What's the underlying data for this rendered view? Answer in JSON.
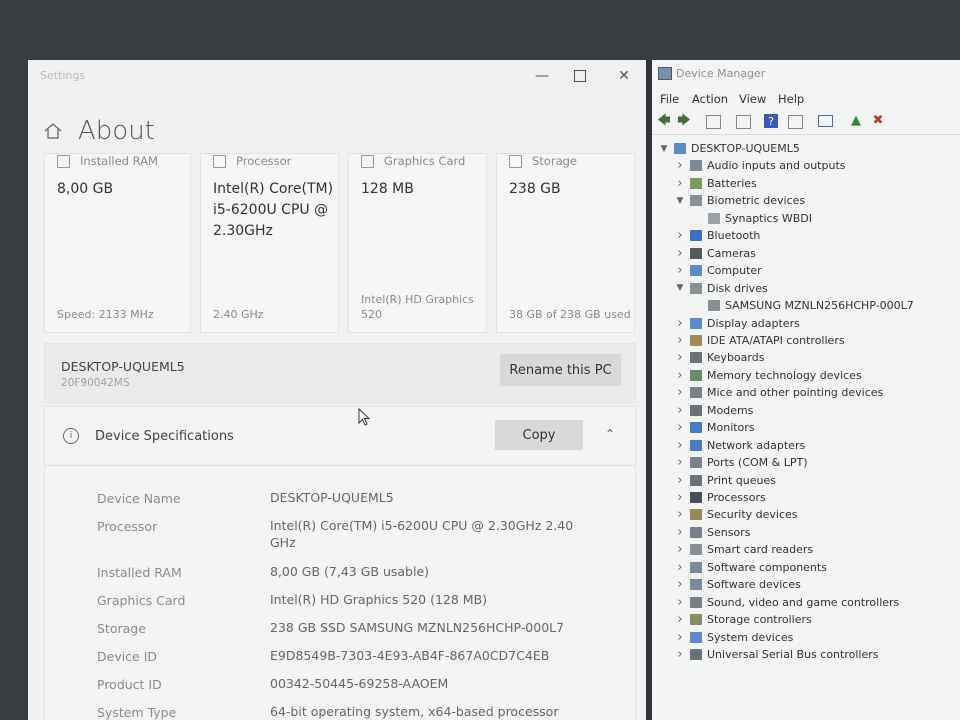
{
  "settings": {
    "app_title": "Settings",
    "page_title": "About",
    "tiles": [
      {
        "label": "Installed RAM",
        "value": "8,00 GB",
        "sub": "Speed: 2133 MHz"
      },
      {
        "label": "Processor",
        "value": "Intel(R) Core(TM) i5-6200U CPU @ 2.30GHz",
        "sub": "2.40 GHz"
      },
      {
        "label": "Graphics Card",
        "value": "128 MB",
        "sub": "Intel(R) HD Graphics 520"
      },
      {
        "label": "Storage",
        "value": "238 GB",
        "sub": "38 GB of 238 GB used"
      }
    ],
    "pc_name": "DESKTOP-UQUEML5",
    "pc_model": "20F90042MS",
    "rename_label": "Rename this PC",
    "spec_title": "Device Specifications",
    "copy_label": "Copy",
    "specs": [
      {
        "label": "Device Name",
        "value": "DESKTOP-UQUEML5"
      },
      {
        "label": "Processor",
        "value": "Intel(R) Core(TM) i5-6200U CPU @ 2.30GHz   2.40 GHz"
      },
      {
        "label": "Installed RAM",
        "value": "8,00 GB (7,43 GB usable)"
      },
      {
        "label": "Graphics Card",
        "value": "Intel(R) HD Graphics 520 (128 MB)"
      },
      {
        "label": "Storage",
        "value": "238 GB SSD SAMSUNG MZNLN256HCHP-000L7"
      },
      {
        "label": "Device ID",
        "value": "E9D8549B-7303-4E93-AB4F-867A0CD7C4EB"
      },
      {
        "label": "Product ID",
        "value": "00342-50445-69258-AAOEM"
      },
      {
        "label": "System Type",
        "value": "64-bit operating system, x64-based processor"
      }
    ]
  },
  "devmgr": {
    "title": "Device Manager",
    "menu": [
      "File",
      "Action",
      "View",
      "Help"
    ],
    "root": "DESKTOP-UQUEML5",
    "nodes": [
      {
        "label": "Audio inputs and outputs",
        "level": 1,
        "state": "collapsed",
        "color": "#7e8c98"
      },
      {
        "label": "Batteries",
        "level": 1,
        "state": "collapsed",
        "color": "#7a9a5a"
      },
      {
        "label": "Biometric devices",
        "level": 1,
        "state": "expanded",
        "color": "#8a8f95"
      },
      {
        "label": "Synaptics WBDI",
        "level": 2,
        "state": "leaf",
        "color": "#9aa0a6"
      },
      {
        "label": "Bluetooth",
        "level": 1,
        "state": "collapsed",
        "color": "#3a6fc8"
      },
      {
        "label": "Cameras",
        "level": 1,
        "state": "collapsed",
        "color": "#555a60"
      },
      {
        "label": "Computer",
        "level": 1,
        "state": "collapsed",
        "color": "#5a8ac8"
      },
      {
        "label": "Disk drives",
        "level": 1,
        "state": "expanded",
        "color": "#8a8f95"
      },
      {
        "label": "SAMSUNG MZNLN256HCHP-000L7",
        "level": 2,
        "state": "leaf",
        "color": "#8a8f95"
      },
      {
        "label": "Display adapters",
        "level": 1,
        "state": "collapsed",
        "color": "#5a8ac8"
      },
      {
        "label": "IDE ATA/ATAPI controllers",
        "level": 1,
        "state": "collapsed",
        "color": "#a08a5a"
      },
      {
        "label": "Keyboards",
        "level": 1,
        "state": "collapsed",
        "color": "#6a7078"
      },
      {
        "label": "Memory technology devices",
        "level": 1,
        "state": "collapsed",
        "color": "#6a8a6a"
      },
      {
        "label": "Mice and other pointing devices",
        "level": 1,
        "state": "collapsed",
        "color": "#7a8088"
      },
      {
        "label": "Modems",
        "level": 1,
        "state": "collapsed",
        "color": "#6a7078"
      },
      {
        "label": "Monitors",
        "level": 1,
        "state": "collapsed",
        "color": "#4a7ac8"
      },
      {
        "label": "Network adapters",
        "level": 1,
        "state": "collapsed",
        "color": "#4a7ac8"
      },
      {
        "label": "Ports (COM & LPT)",
        "level": 1,
        "state": "collapsed",
        "color": "#7a8088"
      },
      {
        "label": "Print queues",
        "level": 1,
        "state": "collapsed",
        "color": "#6a7078"
      },
      {
        "label": "Processors",
        "level": 1,
        "state": "collapsed",
        "color": "#4a5058"
      },
      {
        "label": "Security devices",
        "level": 1,
        "state": "collapsed",
        "color": "#9a8a5a"
      },
      {
        "label": "Sensors",
        "level": 1,
        "state": "collapsed",
        "color": "#7a8088"
      },
      {
        "label": "Smart card readers",
        "level": 1,
        "state": "collapsed",
        "color": "#8a8f95"
      },
      {
        "label": "Software components",
        "level": 1,
        "state": "collapsed",
        "color": "#7a8a9a"
      },
      {
        "label": "Software devices",
        "level": 1,
        "state": "collapsed",
        "color": "#7a8a9a"
      },
      {
        "label": "Sound, video and game controllers",
        "level": 1,
        "state": "collapsed",
        "color": "#7a8088"
      },
      {
        "label": "Storage controllers",
        "level": 1,
        "state": "collapsed",
        "color": "#8a8a6a"
      },
      {
        "label": "System devices",
        "level": 1,
        "state": "collapsed",
        "color": "#5a8ac8"
      },
      {
        "label": "Universal Serial Bus controllers",
        "level": 1,
        "state": "collapsed",
        "color": "#6a7078"
      }
    ]
  },
  "colors": {
    "settings_bg": "#f0f1f0",
    "button_bg": "#d8d9d8",
    "devmgr_bg": "#f3f4f4",
    "error_red": "#c0392b",
    "ok_green": "#2e8b3a"
  }
}
